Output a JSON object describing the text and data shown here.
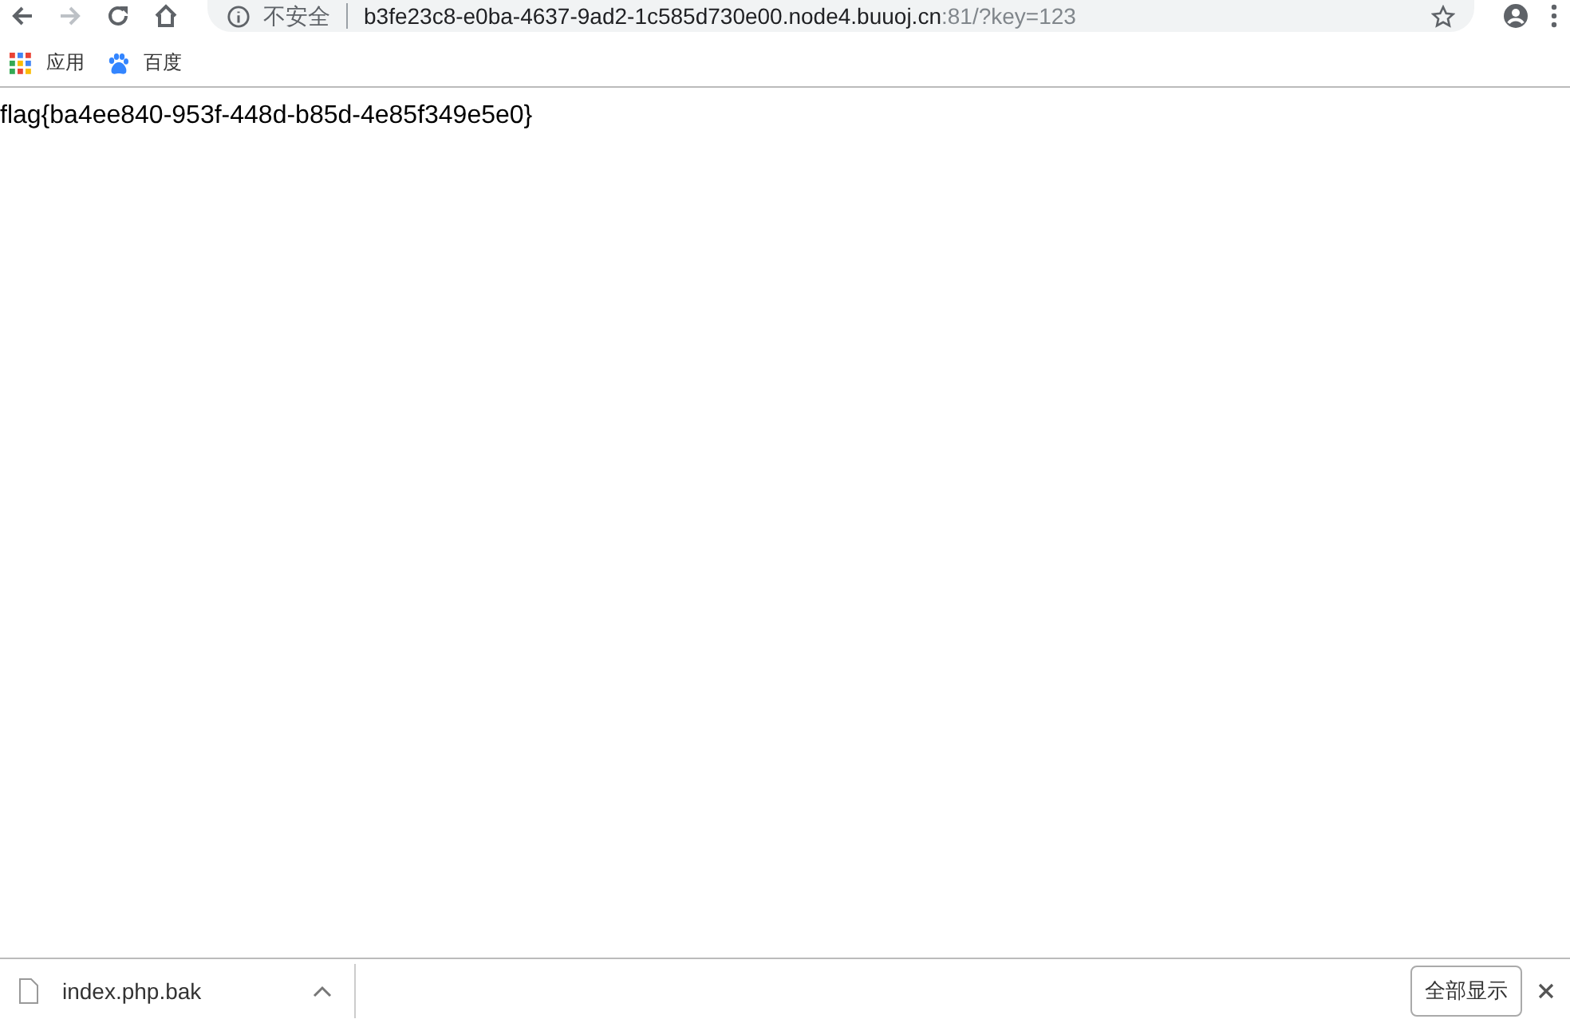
{
  "address_bar": {
    "security_label": "不安全",
    "host": "b3fe23c8-e0ba-4637-9ad2-1c585d730e00.node4.buuoj.cn",
    "path": ":81/?key=123"
  },
  "bookmarks": [
    {
      "label": "应用",
      "kind": "apps"
    },
    {
      "label": "百度",
      "kind": "paw"
    }
  ],
  "page": {
    "text": "flag{ba4ee840-953f-448d-b85d-4e85f349e5e0}"
  },
  "download_bar": {
    "file": "index.php.bak",
    "show_all_button": "全部显示"
  }
}
